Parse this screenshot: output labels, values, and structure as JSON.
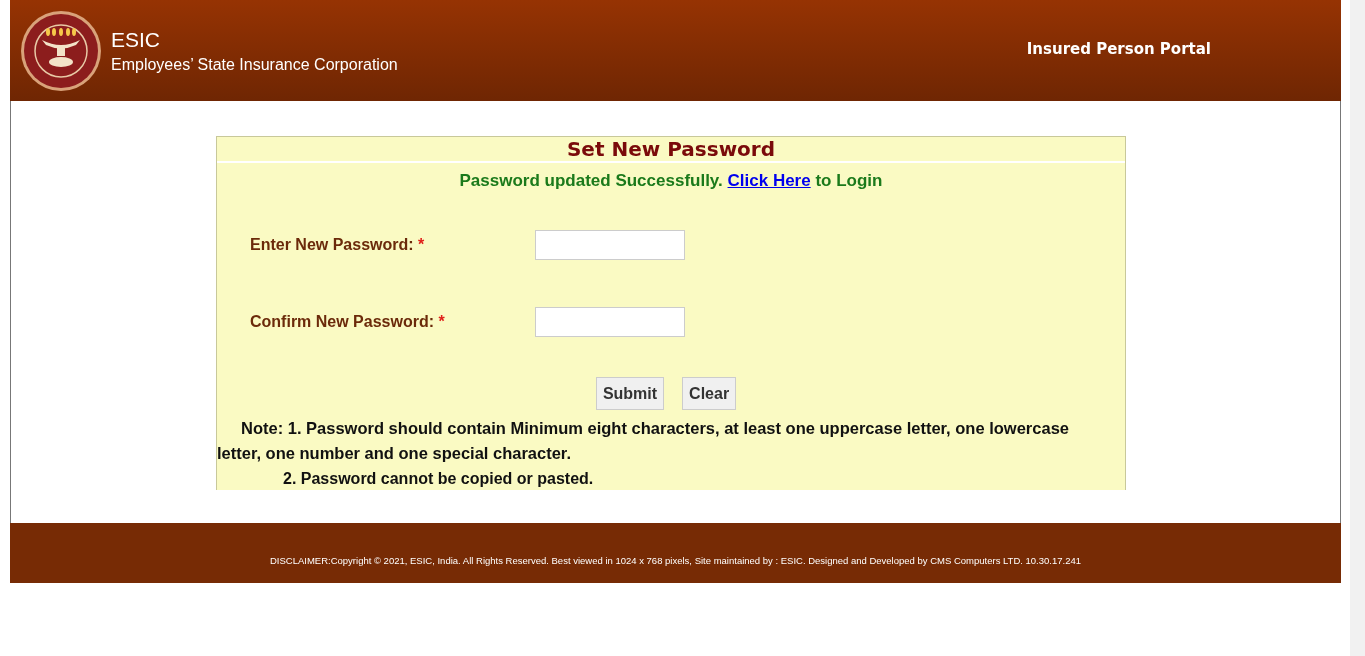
{
  "header": {
    "title": "ESIC",
    "subtitle": "Employees’ State Insurance Corporation",
    "portal": "Insured Person Portal"
  },
  "form": {
    "title": "Set New Password",
    "message": {
      "before": "Password updated Successfully.",
      "link": "Click Here",
      "after": "to Login"
    },
    "fields": [
      {
        "label": "Enter New Password:",
        "required_mark": "*"
      },
      {
        "label": "Confirm New Password:",
        "required_mark": "*"
      }
    ],
    "buttons": [
      "Submit",
      "Clear"
    ],
    "notes": [
      "Note: 1. Password should contain Minimum eight characters, at least one uppercase letter, one lowercase letter, one number and one special character.",
      "2. Password cannot be copied or pasted."
    ]
  },
  "footer": "DISCLAIMER:Copyright © 2021, ESIC, India. All Rights Reserved. Best viewed in 1024 x 768 pixels, Site maintained by : ESIC. Designed and Developed by CMS Computers LTD. 10.30.17.241"
}
